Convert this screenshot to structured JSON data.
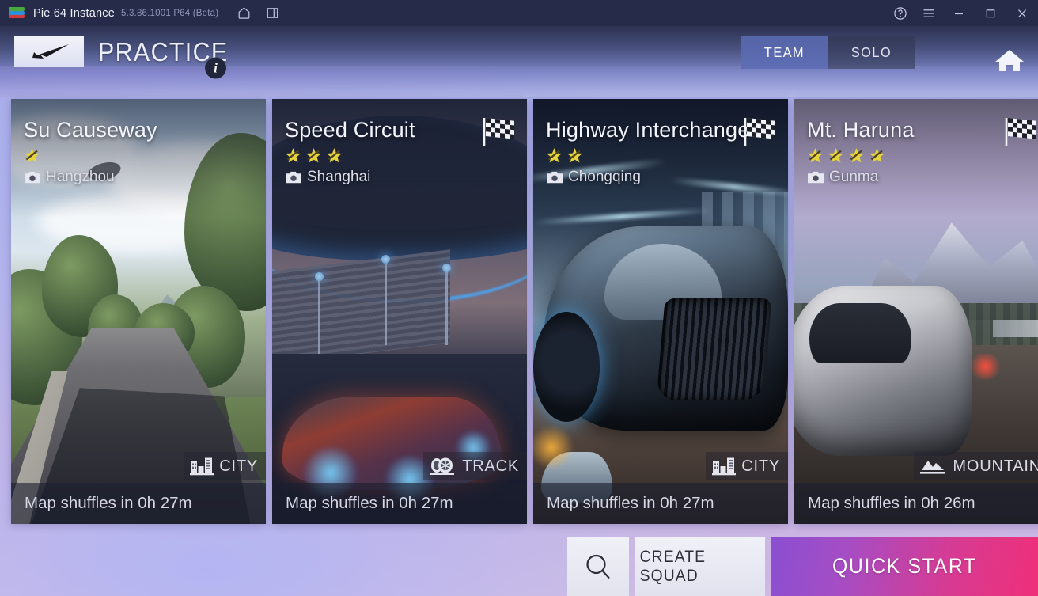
{
  "titlebar": {
    "instance_name": "Pie 64 Instance",
    "version": "5.3.86.1001 P64 (Beta)",
    "left_icons": [
      {
        "name": "home-icon"
      },
      {
        "name": "multi-instance-icon"
      }
    ],
    "right_icons": [
      {
        "name": "help-icon"
      },
      {
        "name": "hamburger-menu-icon"
      },
      {
        "name": "minimize-icon"
      },
      {
        "name": "maximize-icon"
      },
      {
        "name": "close-icon"
      }
    ]
  },
  "header": {
    "back_icon": "back-arrow-icon",
    "title": "PRACTICE",
    "info_label": "i",
    "tabs": [
      {
        "label": "TEAM",
        "active": true
      },
      {
        "label": "SOLO",
        "active": false
      }
    ],
    "home_icon": "home-icon"
  },
  "cards": [
    {
      "title": "Su Causeway",
      "stars": 1,
      "location": "Hangzhou",
      "type_label": "CITY",
      "type_icon": "city-buildings-icon",
      "shuffle_text": "Map shuffles in 0h 27m",
      "has_flag": false
    },
    {
      "title": "Speed Circuit",
      "stars": 3,
      "location": "Shanghai",
      "type_label": "TRACK",
      "type_icon": "tire-track-icon",
      "shuffle_text": "Map shuffles in 0h 27m",
      "has_flag": true
    },
    {
      "title": "Highway Interchange",
      "stars": 2,
      "location": "Chongqing",
      "type_label": "CITY",
      "type_icon": "city-buildings-icon",
      "shuffle_text": "Map shuffles in 0h 27m",
      "has_flag": true
    },
    {
      "title": "Mt. Haruna",
      "stars": 4,
      "location": "Gunma",
      "type_label": "MOUNTAIN",
      "type_icon": "mountain-icon",
      "shuffle_text": "Map shuffles in 0h 26m",
      "has_flag": true
    }
  ],
  "actions": {
    "search_icon": "search-icon",
    "create_squad_label": "CREATE SQUAD",
    "quick_start_label": "QUICK START"
  },
  "colors": {
    "titlebar_bg": "#272b4a",
    "accent_quick_start_from": "#8a4fd1",
    "accent_quick_start_to": "#ef2f79",
    "star_gold": "#e8d43a",
    "tab_active_bg": "#5c6cb4",
    "page_bg": "#b3b4ec"
  }
}
